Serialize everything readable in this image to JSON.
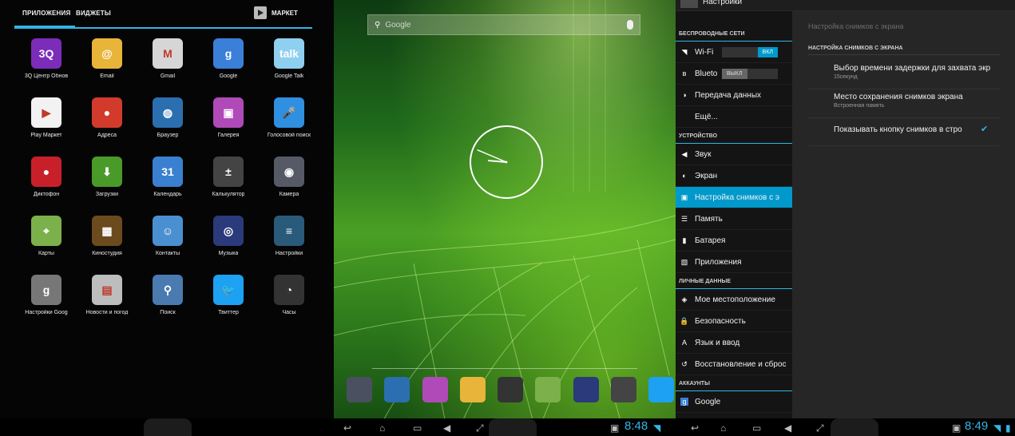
{
  "drawer": {
    "tab_apps": "ПРИЛОЖЕНИЯ",
    "tab_widgets": "ВИДЖЕТЫ",
    "market": "МАРКЕТ",
    "apps": [
      {
        "label": "3Q Центр Обнов",
        "icon": "3q-update-icon",
        "color": "#7b2cb8",
        "glyph": "3Q"
      },
      {
        "label": "Email",
        "icon": "email-icon",
        "color": "#e8b43a",
        "glyph": "@"
      },
      {
        "label": "Gmail",
        "icon": "gmail-icon",
        "color": "#d6d6d6",
        "glyph": "M"
      },
      {
        "label": "Google",
        "icon": "google-search-icon",
        "color": "#3a7fd8",
        "glyph": "g"
      },
      {
        "label": "Google Talk",
        "icon": "google-talk-icon",
        "color": "#8fcff0",
        "glyph": "talk"
      },
      {
        "label": "Play Маркет",
        "icon": "play-market-icon",
        "color": "#f2f2f2",
        "glyph": "▶"
      },
      {
        "label": "Адреса",
        "icon": "places-icon",
        "color": "#d23a2c",
        "glyph": "●"
      },
      {
        "label": "Браузер",
        "icon": "browser-icon",
        "color": "#2b6fb0",
        "glyph": "◍"
      },
      {
        "label": "Галерея",
        "icon": "gallery-icon",
        "color": "#b04ab8",
        "glyph": "▣"
      },
      {
        "label": "Голосовой поиск",
        "icon": "voice-search-icon",
        "color": "#2f8fe0",
        "glyph": "🎤"
      },
      {
        "label": "Диктофон",
        "icon": "recorder-icon",
        "color": "#c8202a",
        "glyph": "●"
      },
      {
        "label": "Загрузки",
        "icon": "downloads-icon",
        "color": "#4a9a2a",
        "glyph": "⬇"
      },
      {
        "label": "Календарь",
        "icon": "calendar-icon",
        "color": "#3a80d0",
        "glyph": "31"
      },
      {
        "label": "Калькулятор",
        "icon": "calculator-icon",
        "color": "#444",
        "glyph": "±"
      },
      {
        "label": "Камера",
        "icon": "camera-icon",
        "color": "#555a66",
        "glyph": "◉"
      },
      {
        "label": "Карты",
        "icon": "maps-icon",
        "color": "#7bb04a",
        "glyph": "⌖"
      },
      {
        "label": "Киностудия",
        "icon": "movie-studio-icon",
        "color": "#6b4a1e",
        "glyph": "▦"
      },
      {
        "label": "Контакты",
        "icon": "contacts-icon",
        "color": "#4a90d0",
        "glyph": "☺"
      },
      {
        "label": "Музыка",
        "icon": "music-icon",
        "color": "#2a3a7a",
        "glyph": "◎"
      },
      {
        "label": "Настройки",
        "icon": "settings-icon",
        "color": "#2a5a7a",
        "glyph": "≡"
      },
      {
        "label": "Настройки Goog",
        "icon": "google-settings-icon",
        "color": "#777",
        "glyph": "g"
      },
      {
        "label": "Новости и погод",
        "icon": "news-weather-icon",
        "color": "#bdbdbd",
        "glyph": "▤"
      },
      {
        "label": "Поиск",
        "icon": "search-icon",
        "color": "#4a7ab0",
        "glyph": "⚲"
      },
      {
        "label": "Твиттер",
        "icon": "twitter-icon",
        "color": "#1da1f2",
        "glyph": "🐦"
      },
      {
        "label": "Часы",
        "icon": "clock-icon",
        "color": "#333",
        "glyph": "◔"
      }
    ]
  },
  "home": {
    "search_placeholder": "Google",
    "dock": [
      {
        "icon": "camera-icon",
        "color": "#4a5060"
      },
      {
        "icon": "browser-icon",
        "color": "#2b6fb0"
      },
      {
        "icon": "gallery-icon",
        "color": "#b04ab8"
      },
      {
        "icon": "email-icon",
        "color": "#e8b43a"
      },
      {
        "icon": "all-apps-icon",
        "color": "#333333"
      },
      {
        "icon": "maps-icon",
        "color": "#7bb04a"
      },
      {
        "icon": "music-icon",
        "color": "#2a3a7a"
      },
      {
        "icon": "calculator-icon",
        "color": "#444444"
      },
      {
        "icon": "twitter-icon",
        "color": "#1da1f2"
      }
    ]
  },
  "settings": {
    "title": "Настройки",
    "cat_wireless": "БЕСПРОВОДНЫЕ СЕТИ",
    "wifi": "Wi-Fi",
    "wifi_toggle": "ВКЛ",
    "bluetooth": "Blueto",
    "bt_toggle": "ВЫКЛ",
    "data": "Передача данных",
    "more": "Ещё...",
    "cat_device": "УСТРОЙСТВО",
    "sound": "Звук",
    "screen": "Экран",
    "screenshot": "Настройка снимков с э",
    "memory": "Память",
    "battery": "Батарея",
    "apps": "Приложения",
    "cat_personal": "ЛИЧНЫЕ ДАННЫЕ",
    "location": "Мое местоположение",
    "security": "Безопасность",
    "language": "Язык и ввод",
    "backup": "Восстановление и сброс",
    "cat_accounts": "АККАУНТЫ",
    "google": "Google",
    "right_header": "Настройка снимков с экрана",
    "right_cat": "НАСТРОЙКА СНИМКОВ С ЭКРАНА",
    "pref1_title": "Выбор времени задержки для захвата экр",
    "pref1_summary": "15секунд",
    "pref2_title": "Место сохранения снимков экрана",
    "pref2_summary": "Встроенная память",
    "pref3_title": "Показывать кнопку снимков в стро",
    "pref3_checked": "✔"
  },
  "statusbar": {
    "time_middle": "8:48",
    "time_right": "8:49"
  }
}
